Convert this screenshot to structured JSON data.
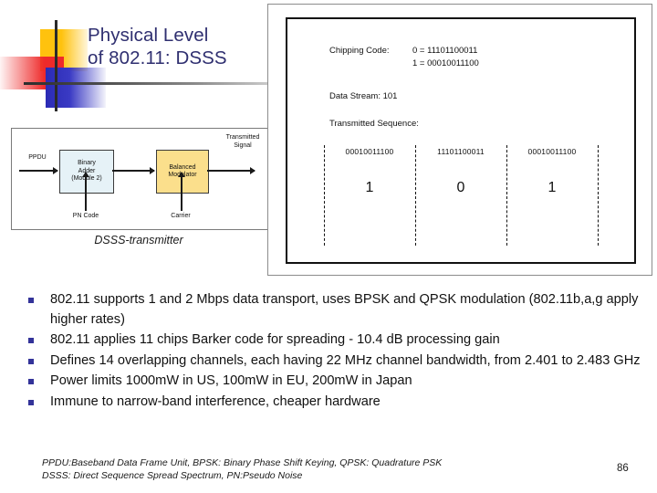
{
  "slide": {
    "title": "Physical Level\nof 802.11: DSSS",
    "page_number": "86",
    "title_color": "#2f2f70",
    "bullet_color": "#333399"
  },
  "transmitter_figure": {
    "caption": "DSSS-transmitter",
    "input_label": "PPDU",
    "adder_label": "Binary\nAdder\n(Module 2)",
    "modulator_label": "Balanced\nModulator",
    "pn_code_label": "PN Code",
    "carrier_label": "Carrier",
    "output_label": "Transmitted\nSignal",
    "adder_fill": "#e6f2f7",
    "modulator_fill": "#fbdf8c"
  },
  "chipping_figure": {
    "chipping_code_label": "Chipping Code:",
    "chipping_code_values": "0 = 11101100011\n1 = 00010011100",
    "data_stream": "Data Stream: 101",
    "transmitted_sequence_label": "Transmitted Sequence:",
    "sequence_cells": [
      {
        "bits": "00010011100",
        "bit": "1"
      },
      {
        "bits": "11101100011",
        "bit": "0"
      },
      {
        "bits": "00010011100",
        "bit": "1"
      }
    ]
  },
  "bullets": [
    "802.11 supports 1 and 2 Mbps data transport, uses BPSK and QPSK modulation (802.11b,a,g apply higher rates)",
    "802.11 applies 11 chips Barker code for spreading - 10.4 dB processing gain",
    "Defines 14 overlapping channels, each having 22 MHz channel bandwidth, from 2.401 to 2.483 GHz",
    "Power limits 1000mW in US, 100mW in EU, 200mW in Japan",
    "Immune to narrow-band interference, cheaper hardware"
  ],
  "footer": {
    "note": "PPDU:Baseband Data Frame Unit, BPSK: Binary Phase Shift Keying, QPSK: Quadrature PSK\nDSSS: Direct Sequence Spread Spectrum, PN:Pseudo Noise"
  }
}
